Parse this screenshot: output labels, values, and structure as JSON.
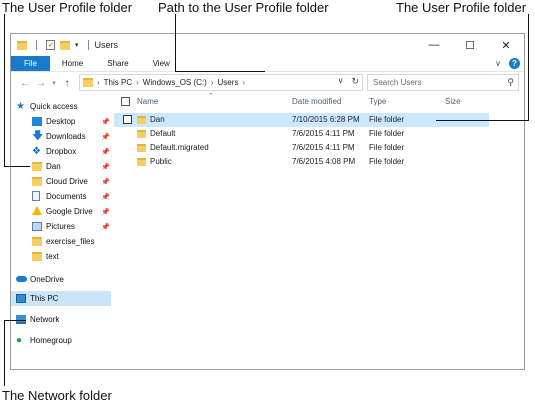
{
  "callouts": {
    "user_profile_left": "The User Profile folder",
    "path": "Path to the User Profile folder",
    "user_profile_right": "The User Profile folder",
    "network": "The Network folder"
  },
  "window": {
    "title": "Users",
    "controls": {
      "minimize": "—",
      "maximize": "☐",
      "close": "✕"
    }
  },
  "ribbon": {
    "tabs": [
      "File",
      "Home",
      "Share",
      "View"
    ]
  },
  "address": {
    "crumbs": [
      "This PC",
      "Windows_OS (C:)",
      "Users"
    ],
    "search_placeholder": "Search Users"
  },
  "nav": {
    "quick_access": "Quick access",
    "items": [
      {
        "label": "Desktop",
        "icon": "desktop-icon",
        "pinned": true
      },
      {
        "label": "Downloads",
        "icon": "download-arrow-icon",
        "pinned": true
      },
      {
        "label": "Dropbox",
        "icon": "dropbox-icon",
        "pinned": true
      },
      {
        "label": "Dan",
        "icon": "folder-icon",
        "pinned": true
      },
      {
        "label": "Cloud Drive",
        "icon": "folder-icon",
        "pinned": true
      },
      {
        "label": "Documents",
        "icon": "documents-icon",
        "pinned": true
      },
      {
        "label": "Google Drive",
        "icon": "google-drive-icon",
        "pinned": true
      },
      {
        "label": "Pictures",
        "icon": "pictures-icon",
        "pinned": true
      },
      {
        "label": "exercise_files",
        "icon": "folder-icon",
        "pinned": false
      },
      {
        "label": "text",
        "icon": "folder-icon",
        "pinned": false
      }
    ],
    "onedrive": "OneDrive",
    "this_pc": "This PC",
    "network": "Network",
    "homegroup": "Homegroup",
    "pin_glyph": "📌"
  },
  "columns": {
    "name": "Name",
    "date": "Date modified",
    "type": "Type",
    "size": "Size"
  },
  "files": [
    {
      "name": "Dan",
      "date": "7/10/2015 6:28 PM",
      "type": "File folder",
      "selected": true
    },
    {
      "name": "Default",
      "date": "7/6/2015 4:11 PM",
      "type": "File folder",
      "selected": false
    },
    {
      "name": "Default.migrated",
      "date": "7/6/2015 4:11 PM",
      "type": "File folder",
      "selected": false
    },
    {
      "name": "Public",
      "date": "7/6/2015 4:08 PM",
      "type": "File folder",
      "selected": false
    }
  ],
  "colors": {
    "accent": "#1979ca",
    "selection": "#cce8ff",
    "nav_selection": "#cce4f7",
    "folder": "#f5cf63"
  }
}
